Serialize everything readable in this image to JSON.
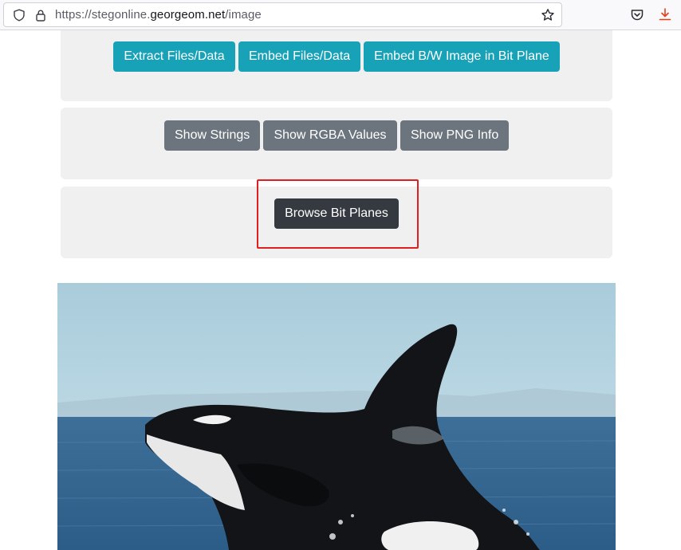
{
  "browser": {
    "url_prefix": "https://stegonline.",
    "url_domain": "georgeom.net",
    "url_path": "/image",
    "icons": [
      "shield-icon",
      "lock-icon",
      "bookmark-star-icon",
      "pocket-icon",
      "download-icon"
    ]
  },
  "actions": {
    "extract_label": "Extract Files/Data",
    "embed_label": "Embed Files/Data",
    "embed_bw_label": "Embed B/W Image in Bit Plane"
  },
  "inspect": {
    "strings_label": "Show Strings",
    "rgba_label": "Show RGBA Values",
    "png_label": "Show PNG Info"
  },
  "bitplanes": {
    "browse_label": "Browse Bit Planes"
  },
  "image": {
    "subject": "orca breaching out of the sea"
  },
  "colors": {
    "info": "#17a2b8",
    "secondary": "#6c757d",
    "dark": "#343a40",
    "highlight": "#e02020"
  }
}
